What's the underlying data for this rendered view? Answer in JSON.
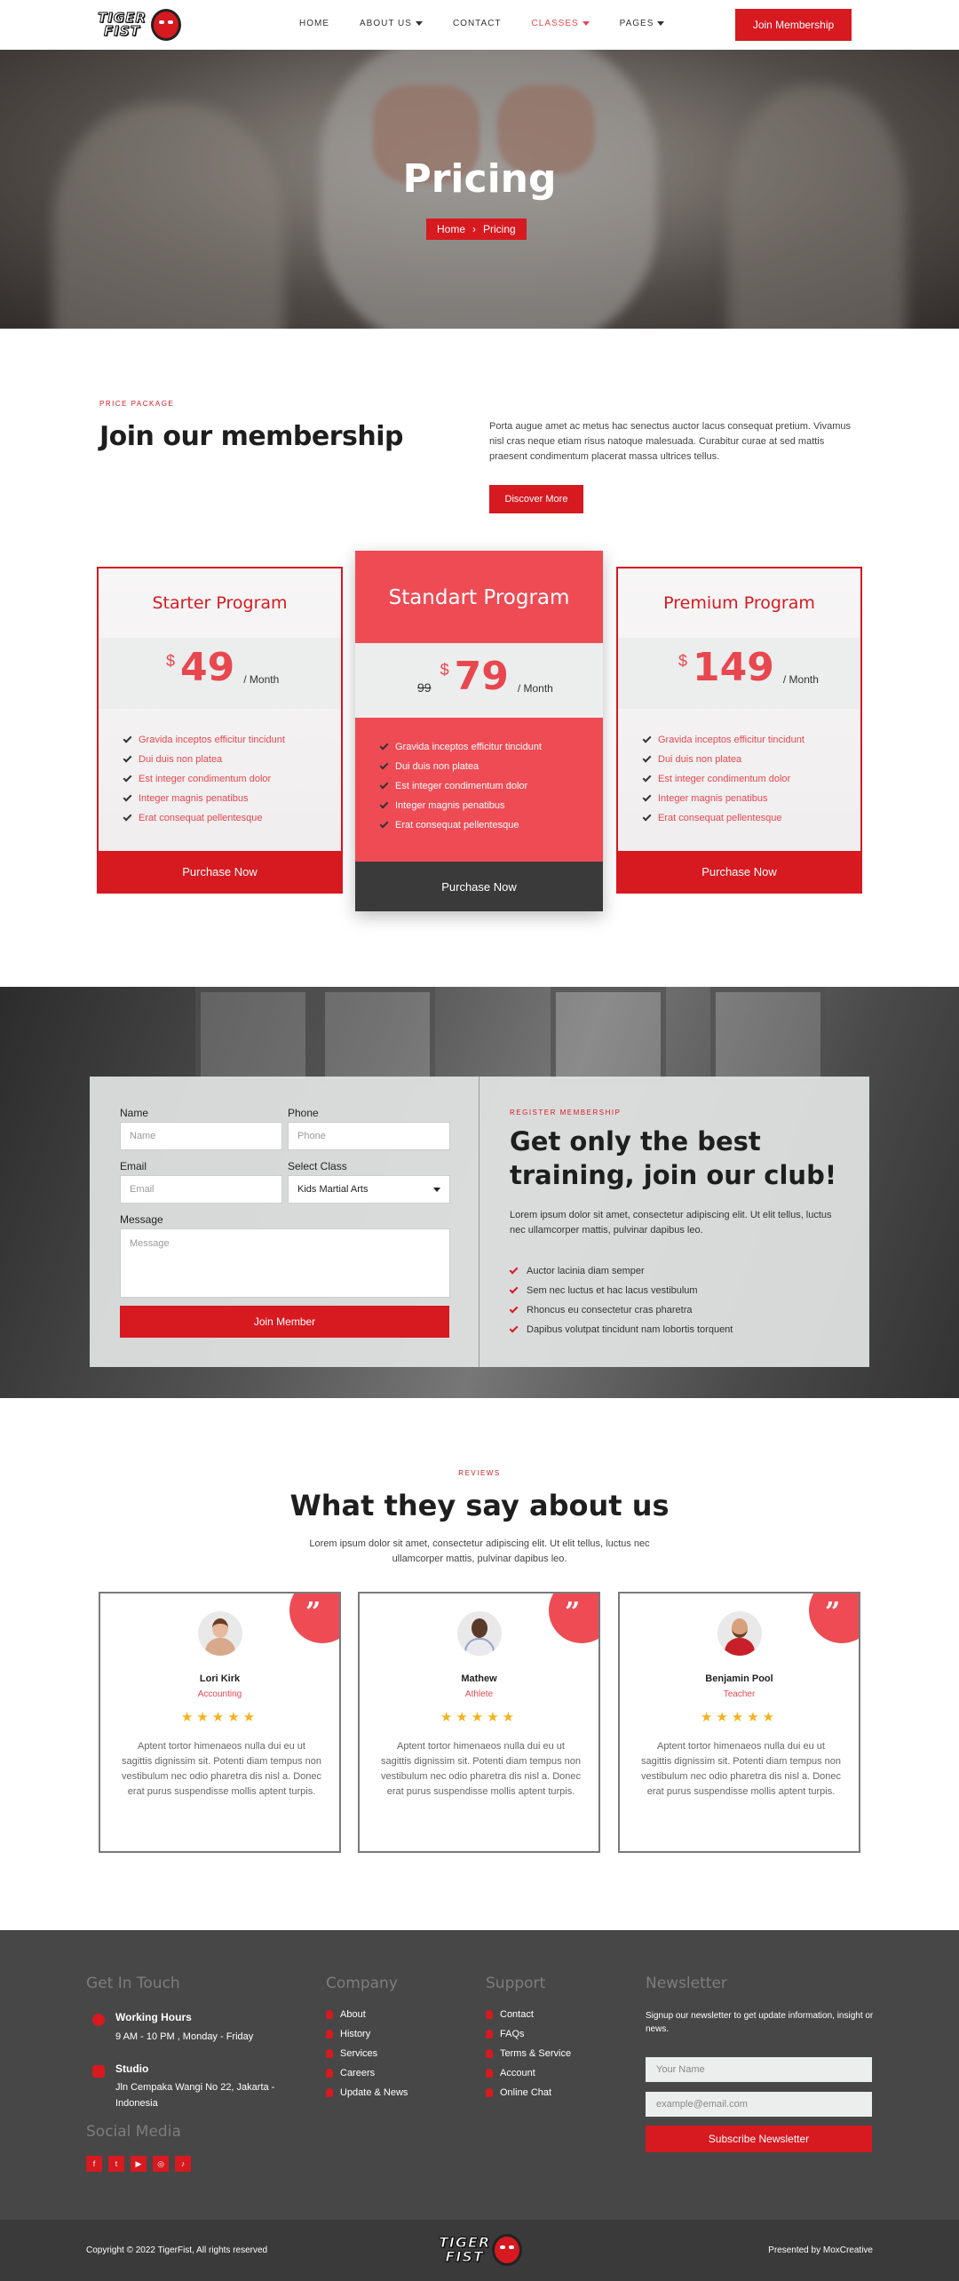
{
  "header": {
    "logo_line1": "TIGER",
    "logo_line2": "FIST",
    "nav": [
      {
        "label": "HOME"
      },
      {
        "label": "ABOUT US"
      },
      {
        "label": "CONTACT"
      },
      {
        "label": "CLASSES"
      },
      {
        "label": "PAGES"
      }
    ],
    "join_label": "Join Membership",
    "accent_color": "#d71920"
  },
  "hero": {
    "title": "Pricing",
    "breadcrumb_home": "Home",
    "breadcrumb_current": "Pricing"
  },
  "intro": {
    "eyebrow": "PRICE PACKAGE",
    "title": "Join our membership",
    "text": "Porta augue amet ac metus hac senectus auctor lacus consequat pretium. Vivamus nisl cras neque etiam risus natoque malesuada. Curabitur curae at sed mattis praesent condimentum placerat massa ultrices tellus.",
    "button": "Discover More"
  },
  "plans": [
    {
      "name": "Starter Program",
      "currency": "$",
      "price": "49",
      "period": "/ Month",
      "features": [
        "Gravida inceptos efficitur tincidunt",
        "Dui duis non platea",
        "Est integer condimentum dolor",
        "Integer magnis penatibus",
        "Erat consequat pellentesque"
      ],
      "button": "Purchase Now"
    },
    {
      "name": "Standart Program",
      "currency": "$",
      "old_price": "99",
      "price": "79",
      "period": "/ Month",
      "features": [
        "Gravida inceptos efficitur tincidunt",
        "Dui duis non platea",
        "Est integer condimentum dolor",
        "Integer magnis penatibus",
        "Erat consequat pellentesque"
      ],
      "button": "Purchase Now"
    },
    {
      "name": "Premium Program",
      "currency": "$",
      "price": "149",
      "period": "/ Month",
      "features": [
        "Gravida inceptos efficitur tincidunt",
        "Dui duis non platea",
        "Est integer condimentum dolor",
        "Integer magnis penatibus",
        "Erat consequat pellentesque"
      ],
      "button": "Purchase Now"
    }
  ],
  "register": {
    "form": {
      "name_label": "Name",
      "name_placeholder": "Name",
      "phone_label": "Phone",
      "phone_placeholder": "Phone",
      "email_label": "Email",
      "email_placeholder": "Email",
      "class_label": "Select Class",
      "class_value": "Kids Martial Arts",
      "message_label": "Message",
      "message_placeholder": "Message",
      "submit": "Join Member"
    },
    "eyebrow": "REGISTER MEMBERSHIP",
    "title": "Get only the best training, join our club!",
    "text": "Lorem ipsum dolor sit amet, consectetur adipiscing elit. Ut elit tellus, luctus nec ullamcorper mattis, pulvinar dapibus leo.",
    "list": [
      "Auctor lacinia diam semper",
      "Sem nec luctus et hac lacus vestibulum",
      "Rhoncus eu consectetur cras pharetra",
      "Dapibus volutpat tincidunt nam lobortis torquent"
    ]
  },
  "reviews": {
    "eyebrow": "REVIEWS",
    "title": "What they say about us",
    "text": "Lorem ipsum dolor sit amet, consectetur adipiscing elit. Ut elit tellus, luctus nec ullamcorper mattis, pulvinar dapibus leo.",
    "items": [
      {
        "name": "Lori Kirk",
        "role": "Accounting",
        "stars": "★★★★★",
        "body": "Aptent tortor himenaeos nulla dui eu ut sagittis dignissim sit. Potenti diam tempus non vestibulum nec odio pharetra dis nisl a. Donec erat purus suspendisse mollis aptent turpis."
      },
      {
        "name": "Mathew",
        "role": "Athlete",
        "stars": "★★★★★",
        "body": "Aptent tortor himenaeos nulla dui eu ut sagittis dignissim sit. Potenti diam tempus non vestibulum nec odio pharetra dis nisl a. Donec erat purus suspendisse mollis aptent turpis."
      },
      {
        "name": "Benjamin Pool",
        "role": "Teacher",
        "stars": "★★★★★",
        "body": "Aptent tortor himenaeos nulla dui eu ut sagittis dignissim sit. Potenti diam tempus non vestibulum nec odio pharetra dis nisl a. Donec erat purus suspendisse mollis aptent turpis."
      }
    ]
  },
  "footer": {
    "touch_title": "Get In Touch",
    "hours_title": "Working Hours",
    "hours_text": "9 AM - 10 PM , Monday - Friday",
    "studio_title": "Studio",
    "studio_line1": "Jln Cempaka Wangi No 22, Jakarta -",
    "studio_line2": "Indonesia",
    "social_title": "Social Media",
    "social_icons": [
      "facebook-icon",
      "twitter-icon",
      "youtube-icon",
      "instagram-icon",
      "tiktok-icon"
    ],
    "company_title": "Company",
    "company_links": [
      "About",
      "History",
      "Services",
      "Careers",
      "Update & News"
    ],
    "support_title": "Support",
    "support_links": [
      "Contact",
      "FAQs",
      "Terms & Service",
      "Account",
      "Online Chat"
    ],
    "newsletter_title": "Newsletter",
    "newsletter_text": "Signup our newsletter to get update information, insight or news.",
    "name_placeholder": "Your Name",
    "email_placeholder": "example@email.com",
    "subscribe": "Subscribe Newsletter",
    "copyright": "Copyright © 2022 TigerFist, All rights reserved",
    "presented": "Presented by MoxCreative"
  }
}
